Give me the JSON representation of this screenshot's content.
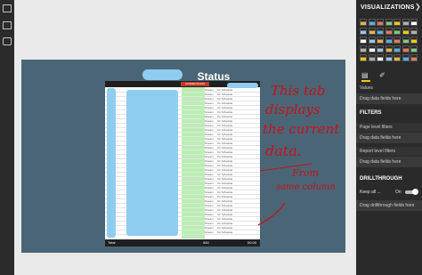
{
  "left_nav": {
    "icons": [
      "report-view-icon",
      "data-view-icon",
      "model-view-icon"
    ]
  },
  "report": {
    "title": "Status",
    "table": {
      "header_highlight": "CURRENTDATA",
      "row_values": [
        "Stream",
        "On Schedule"
      ],
      "footer": {
        "label": "Total",
        "mid": "000",
        "right": "00.00"
      }
    },
    "annotations": [
      "This tab",
      "displays",
      "the current",
      "data.",
      "From",
      "same column"
    ]
  },
  "right_panel": {
    "title": "VISUALIZATIONS",
    "collapse_icon": "chevron-right-icon",
    "tools": [
      "fields-tool-icon",
      "format-paint-icon"
    ],
    "values_label": "Values",
    "values_drop": "Drag data fields here",
    "filters_header": "FILTERS",
    "page_filters": "Page level filters",
    "page_filters_drop": "Drag data fields here",
    "report_filters": "Report level filters",
    "report_filters_drop": "Drag data fields here",
    "drillthrough_header": "DRILLTHROUGH",
    "keep_all": "Keep all ...",
    "keep_all_state": "On",
    "drillthrough_drop": "Drag drillthrough fields here",
    "accent_color": "#f2c811"
  }
}
